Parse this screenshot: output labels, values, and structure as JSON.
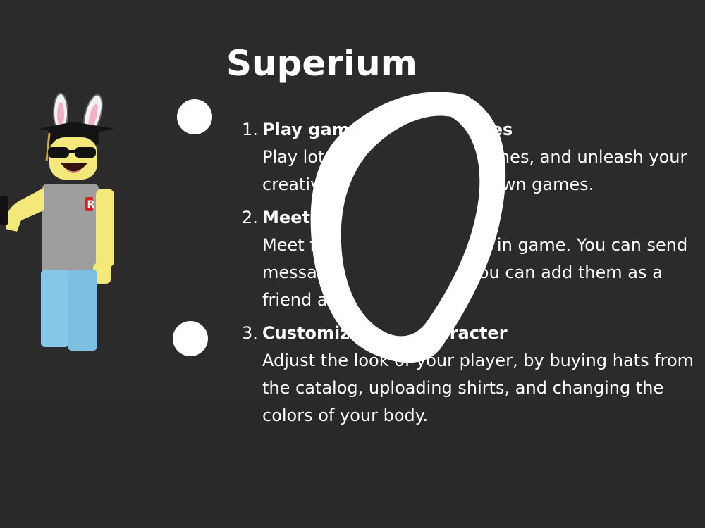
{
  "page": {
    "title": "Superium",
    "avatar_icon": "roblox-avatar-bunny-ears-graduation-cap",
    "accent_colors": {
      "background": "#292929",
      "text": "#ffffff"
    }
  },
  "features": [
    {
      "number": "1.",
      "title": "Play games, create games",
      "description": "Play lots of user-created games, and unleash your creativity by creating your own games."
    },
    {
      "number": "2.",
      "title": "Meet new friends.",
      "description": "Meet friends on the site, or in game. You can send messages to users, and you can add them as a friend as well!"
    },
    {
      "number": "3.",
      "title": "Customize your character",
      "description": "Adjust the look of your player, by buying hats from the catalog, uploading shirts, and changing the colors of your body."
    }
  ],
  "annotation": {
    "icon": "hand-drawn-circle-scribble",
    "color": "#ffffff"
  }
}
